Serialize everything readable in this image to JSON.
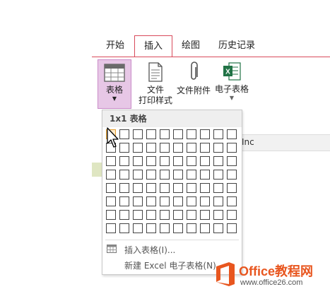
{
  "tabs": [
    {
      "label": "开始",
      "active": false
    },
    {
      "label": "插入",
      "active": true
    },
    {
      "label": "绘图",
      "active": false
    },
    {
      "label": "历史记录",
      "active": false
    }
  ],
  "ribbon": {
    "table_label": "表格",
    "file_printout_label_1": "文件",
    "file_printout_label_2": "打印样式",
    "attachment_label": "文件附件",
    "spreadsheet_label": "电子表格"
  },
  "table_menu": {
    "size_readout": "1x1 表格",
    "grid_rows": 8,
    "grid_cols": 10,
    "insert_table_label": "插入表格(I)...",
    "new_excel_label": "新建 Excel 电子表格(N)"
  },
  "background": {
    "partial_text": "Inc"
  },
  "watermark": {
    "brand": "Office教程网",
    "url": "www.office26.com"
  },
  "colors": {
    "accent": "#d84a5a",
    "pressed": "#e7c7e6",
    "cell_highlight": "#fde9c9",
    "logo_orange": "#e8561f"
  }
}
